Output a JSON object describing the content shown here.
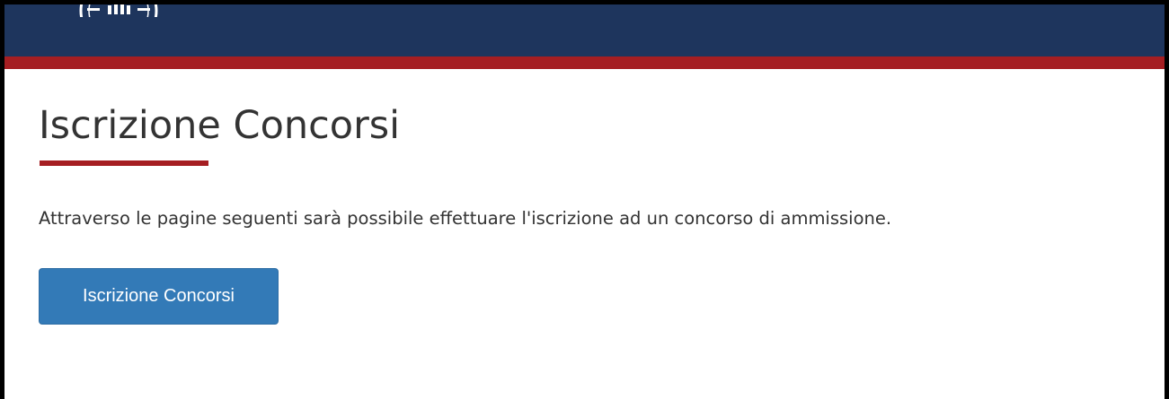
{
  "header": {
    "logo_icon": "university-seal-icon",
    "background_color": "#1e355d",
    "stripe_color": "#a51e22"
  },
  "main": {
    "title": "Iscrizione Concorsi",
    "intro": "Attraverso le pagine seguenti sarà possibile effettuare l'iscrizione ad un concorso di ammissione.",
    "button_label": "Iscrizione Concorsi"
  },
  "colors": {
    "accent": "#a51e22",
    "button": "#337ab7",
    "text": "#333333"
  }
}
